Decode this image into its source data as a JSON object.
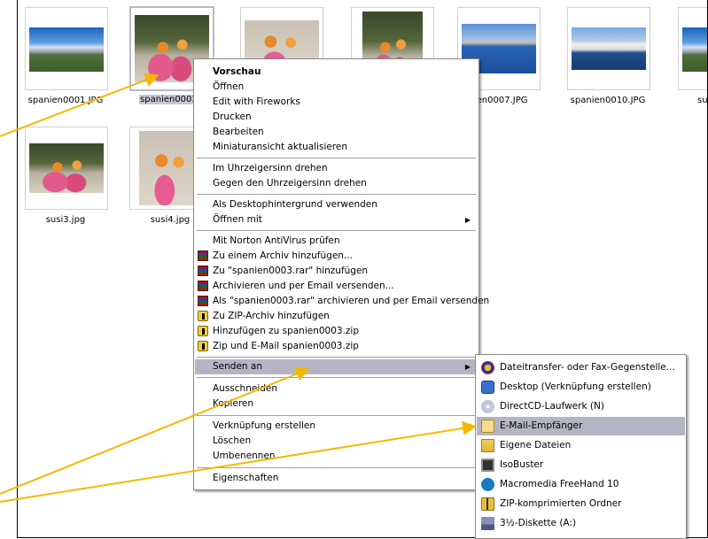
{
  "thumbnails": [
    {
      "caption": "spanien0001.JPG",
      "image": "mountain-photo",
      "selected": false
    },
    {
      "caption": "spanien0003.",
      "image": "picnic-photo",
      "selected": true
    },
    {
      "caption": "",
      "image": "picnic-photo",
      "selected": false
    },
    {
      "caption": "",
      "image": "picnic-photo",
      "selected": false
    },
    {
      "caption": "nien0007.JPG",
      "image": "sea-photo",
      "selected": false
    },
    {
      "caption": "spanien0010.JPG",
      "image": "village-photo",
      "selected": false
    },
    {
      "caption": "su",
      "image": "mountain-photo",
      "selected": false
    },
    {
      "caption": "susi3.jpg",
      "image": "picnic-photo",
      "selected": false
    },
    {
      "caption": "susi4.jpg",
      "image": "picnic-photo",
      "selected": false
    }
  ],
  "context_menu": {
    "items": [
      {
        "label": "Vorschau",
        "bold": true
      },
      {
        "label": "Öffnen"
      },
      {
        "label": "Edit with Fireworks"
      },
      {
        "label": "Drucken"
      },
      {
        "label": "Bearbeiten"
      },
      {
        "label": "Miniaturansicht aktualisieren"
      },
      {
        "label": "Im Uhrzeigersinn drehen"
      },
      {
        "label": "Gegen den Uhrzeigersinn drehen"
      },
      {
        "label": "Als Desktophintergrund verwenden"
      },
      {
        "label": "Öffnen mit",
        "submenu": true
      },
      {
        "label": "Mit Norton AntiVirus prüfen"
      },
      {
        "label": "Zu einem Archiv hinzufügen...",
        "icon": "winrar-icon"
      },
      {
        "label": "Zu \"spanien0003.rar\" hinzufügen",
        "icon": "winrar-icon"
      },
      {
        "label": "Archivieren und per Email versenden...",
        "icon": "winrar-icon"
      },
      {
        "label": "Als \"spanien0003.rar\" archivieren und per Email versenden",
        "icon": "winrar-icon"
      },
      {
        "label": "Zu ZIP-Archiv hinzufügen",
        "icon": "winzip-icon"
      },
      {
        "label": "Hinzufügen zu spanien0003.zip",
        "icon": "winzip-icon"
      },
      {
        "label": "Zip und E-Mail spanien0003.zip",
        "icon": "winzip-icon"
      },
      {
        "label": "Senden an",
        "submenu": true,
        "highlighted": true
      },
      {
        "label": "Ausschneiden"
      },
      {
        "label": "Kopieren"
      },
      {
        "label": "Verknüpfung erstellen"
      },
      {
        "label": "Löschen"
      },
      {
        "label": "Umbenennen"
      },
      {
        "label": "Eigenschaften"
      }
    ]
  },
  "send_to_menu": {
    "items": [
      {
        "label": "Dateitransfer- oder Fax-Gegenstelle...",
        "icon": "fax-transfer-icon"
      },
      {
        "label": "Desktop (Verknüpfung erstellen)",
        "icon": "desktop-icon"
      },
      {
        "label": "DirectCD-Laufwerk (N)",
        "icon": "cd-drive-icon"
      },
      {
        "label": "E-Mail-Empfänger",
        "icon": "mail-recipient-icon",
        "highlighted": true
      },
      {
        "label": "Eigene Dateien",
        "icon": "my-documents-icon"
      },
      {
        "label": "IsoBuster",
        "icon": "isobuster-icon"
      },
      {
        "label": "Macromedia FreeHand 10",
        "icon": "freehand-icon"
      },
      {
        "label": "ZIP-komprimierten Ordner",
        "icon": "zip-folder-icon"
      },
      {
        "label": "3½-Diskette (A:)",
        "icon": "floppy-icon"
      }
    ]
  },
  "colors": {
    "highlight": "#b4b4c4",
    "arrow": "#f5b800"
  }
}
